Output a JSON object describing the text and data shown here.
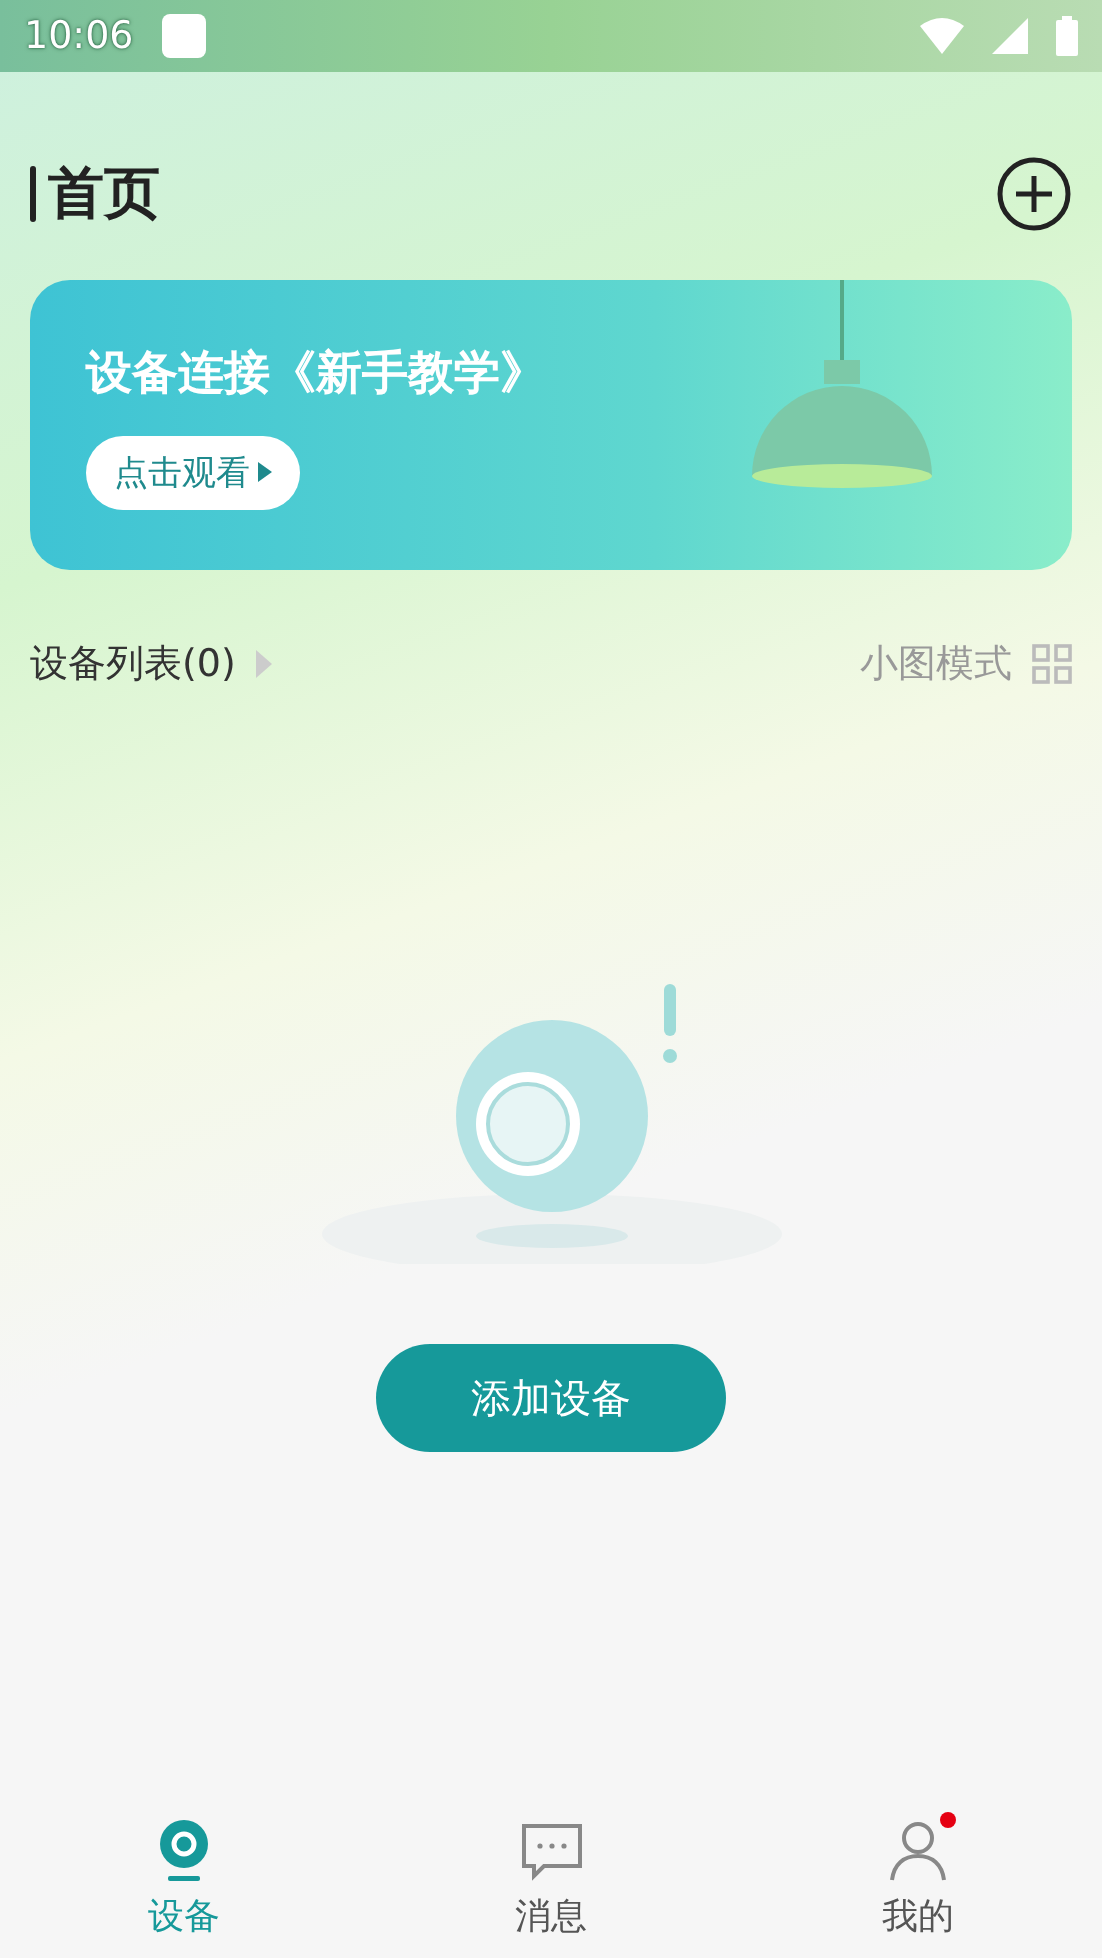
{
  "status_bar": {
    "time": "10:06"
  },
  "header": {
    "title": "首页"
  },
  "banner": {
    "title": "设备连接《新手教学》",
    "button": "点击观看"
  },
  "device_list": {
    "label": "设备列表(0)",
    "view_mode": "小图模式"
  },
  "empty_state": {
    "button": "添加设备"
  },
  "tabs": [
    {
      "label": "设备",
      "selected": true,
      "badge": false
    },
    {
      "label": "消息",
      "selected": false,
      "badge": false
    },
    {
      "label": "我的",
      "selected": false,
      "badge": true
    }
  ]
}
